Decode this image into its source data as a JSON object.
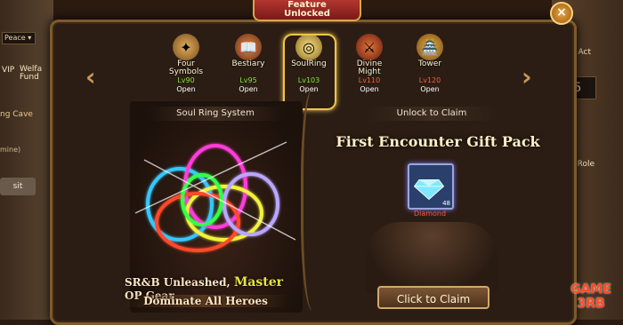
{
  "modal": {
    "title_line1": "Feature",
    "title_line2": "Unlocked",
    "close": "×"
  },
  "background": {
    "peace": "Peace",
    "vip": "VIP",
    "welfare": "Welfa",
    "fund": "Fund",
    "ring_cave": "ng Cave",
    "mine": "mine)",
    "visit": "sit",
    "act": "Act",
    "role": "Role",
    "number": "5"
  },
  "features": [
    {
      "name_line1": "Four",
      "name_line2": "Symbols",
      "level": "Lv90",
      "state": "Open",
      "icon": "four-symbols-icon",
      "locked": false
    },
    {
      "name_line1": "Bestiary",
      "name_line2": "",
      "level": "Lv95",
      "state": "Open",
      "icon": "bestiary-icon",
      "locked": false
    },
    {
      "name_line1": "SoulRing",
      "name_line2": "",
      "level": "Lv103",
      "state": "Open",
      "icon": "soul-ring-icon",
      "locked": false,
      "selected": true
    },
    {
      "name_line1": "Divine",
      "name_line2": "Might",
      "level": "Lv110",
      "state": "Open",
      "icon": "divine-might-icon",
      "locked": true
    },
    {
      "name_line1": "Tower",
      "name_line2": "",
      "level": "Lv120",
      "state": "Open",
      "icon": "tower-icon",
      "locked": true
    }
  ],
  "left": {
    "section_title": "Soul Ring System",
    "promo_part1": "SR&B Unleashed, ",
    "promo_highlight": "Master",
    "promo_part2": " OP Gear",
    "promo_line2": "Dominate All Heroes"
  },
  "right": {
    "section_title": "Unlock to Claim",
    "gift_title": "First Encounter Gift Pack",
    "item_qty": "48",
    "item_name": "Diamond",
    "claim_button": "Click to Claim"
  },
  "watermark": {
    "line1": "GAME",
    "line2": "3RB"
  },
  "colors": {
    "accent_gold": "#d8a54a",
    "level_unlocked": "#7fe23d",
    "level_locked": "#ff5a3b",
    "banner_red": "#b3362f"
  }
}
